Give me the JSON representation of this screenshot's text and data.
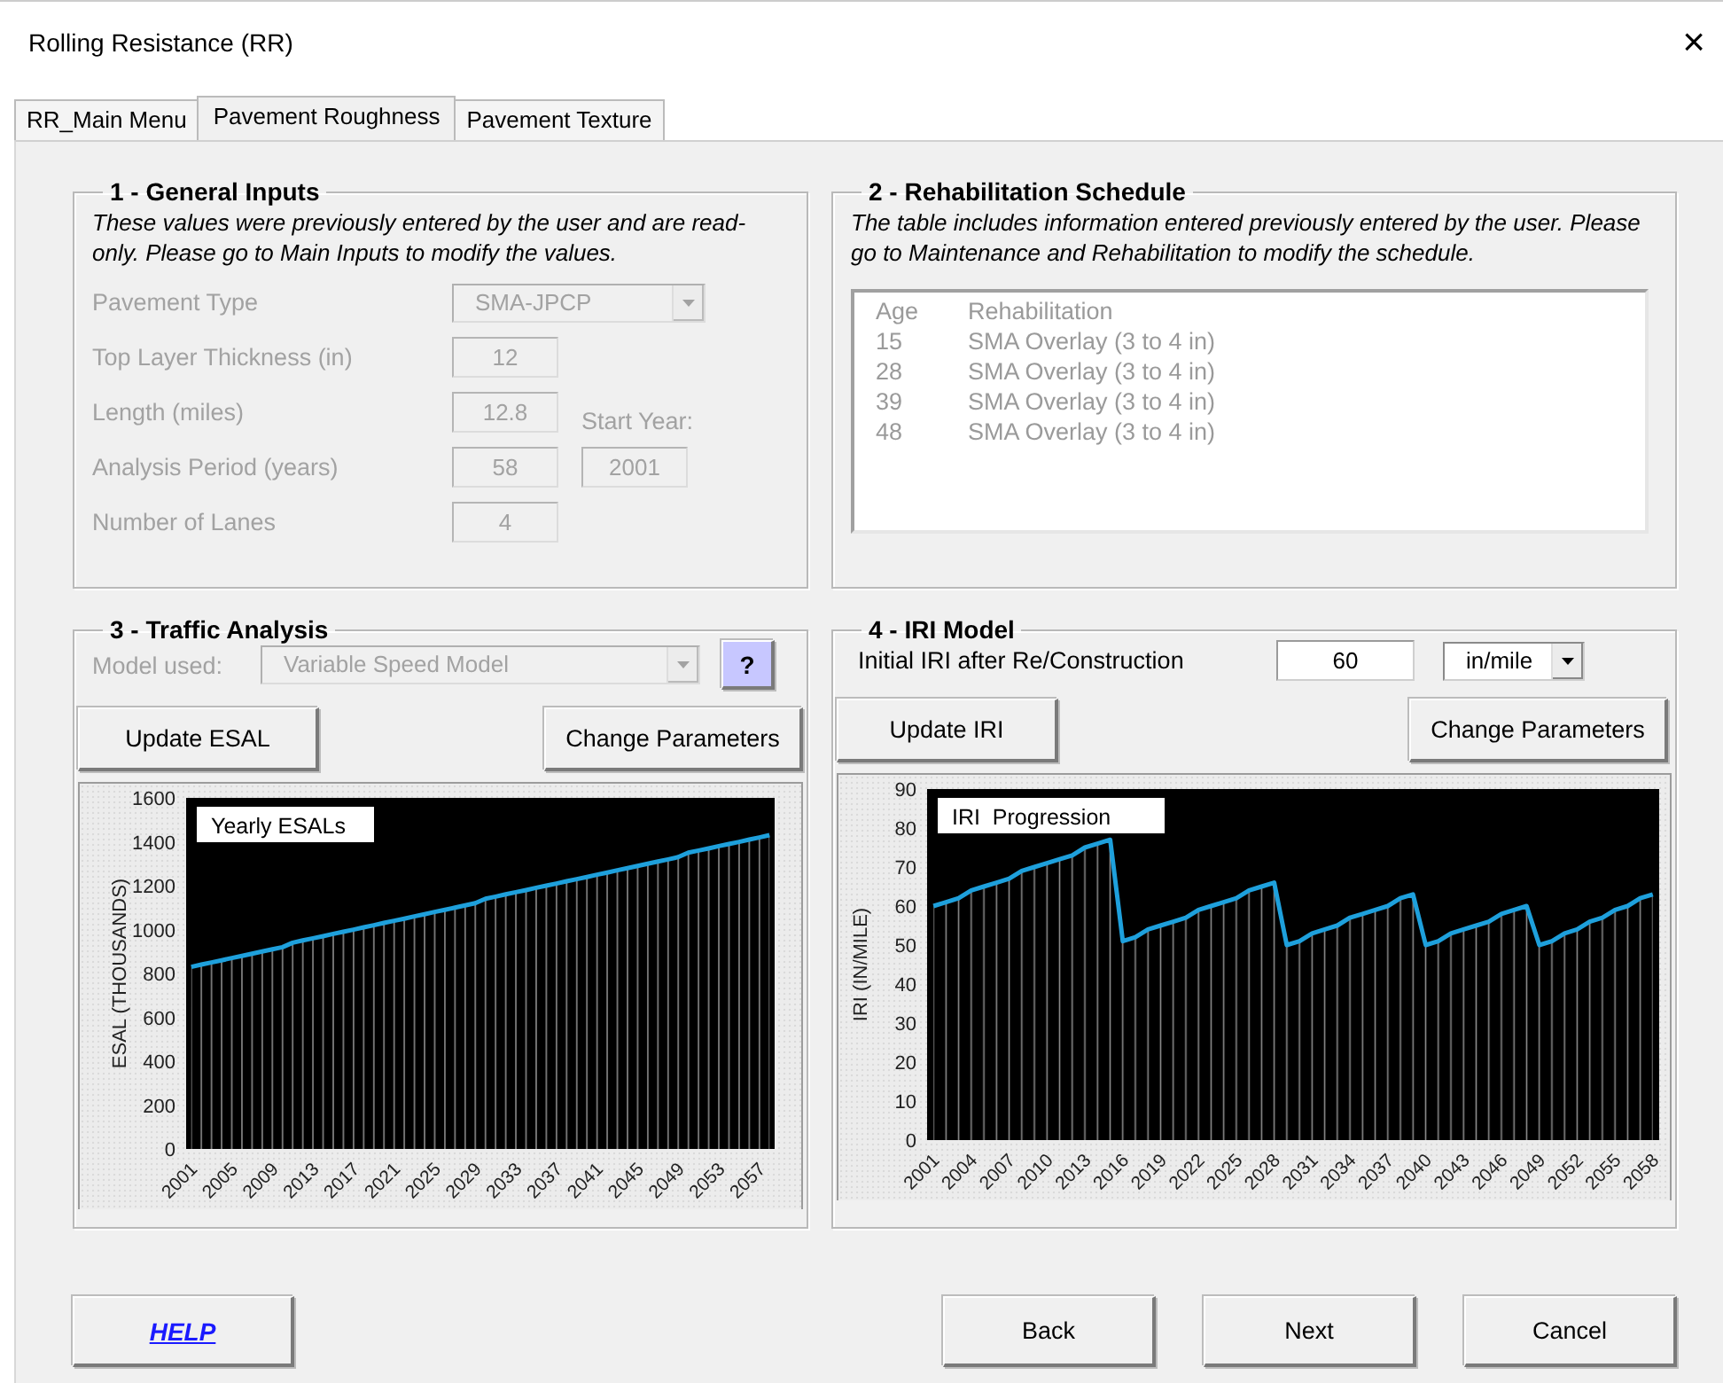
{
  "window": {
    "title": "Rolling Resistance (RR)",
    "close": "×"
  },
  "tabs": [
    {
      "label": "RR_Main Menu",
      "selected": false
    },
    {
      "label": "Pavement Roughness",
      "selected": true
    },
    {
      "label": "Pavement Texture",
      "selected": false
    }
  ],
  "general_inputs": {
    "title": "1 - General Inputs",
    "note": "These values were previously entered by the user and are read-only. Please go to Main Inputs to modify the values.",
    "fields": [
      {
        "label": "Pavement Type",
        "value": "SMA-JPCP",
        "kind": "dropdown",
        "disabled": true
      },
      {
        "label": "Top Layer Thickness (in)",
        "value": "12",
        "kind": "text",
        "disabled": true
      },
      {
        "label": "Length (miles)",
        "value": "12.8",
        "kind": "text",
        "disabled": true
      },
      {
        "label": "Analysis Period (years)",
        "value": "58",
        "kind": "text",
        "disabled": true
      },
      {
        "label": "Number of Lanes",
        "value": "4",
        "kind": "text",
        "disabled": true
      }
    ],
    "start_year": {
      "label": "Start Year:",
      "value": "2001",
      "disabled": true
    }
  },
  "rehabilitation_schedule": {
    "title": "2 - Rehabilitation Schedule",
    "note": "The table includes information entered previously entered by the user. Please go to Maintenance and Rehabilitation to modify the schedule.",
    "disabled": true,
    "columns": [
      "Age",
      "Rehabilitation"
    ],
    "rows": [
      [
        "15",
        "SMA Overlay (3 to 4 in)"
      ],
      [
        "28",
        "SMA Overlay (3 to 4 in)"
      ],
      [
        "39",
        "SMA Overlay (3 to 4 in)"
      ],
      [
        "48",
        "SMA Overlay (3 to 4 in)"
      ]
    ]
  },
  "traffic_analysis": {
    "title": "3 - Traffic Analysis",
    "model": {
      "label": "Model used:",
      "value": "Variable Speed Model",
      "disabled": true
    },
    "help_button": "?",
    "buttons": [
      "Update ESAL",
      "Change Parameters"
    ],
    "chart_data": {
      "type": "area",
      "ylabel": "ESAL (THOUSANDS)",
      "x": [
        2001,
        2002,
        2003,
        2004,
        2005,
        2006,
        2007,
        2008,
        2009,
        2010,
        2011,
        2012,
        2013,
        2014,
        2015,
        2016,
        2017,
        2018,
        2019,
        2020,
        2021,
        2022,
        2023,
        2024,
        2025,
        2026,
        2027,
        2028,
        2029,
        2030,
        2031,
        2032,
        2033,
        2034,
        2035,
        2036,
        2037,
        2038,
        2039,
        2040,
        2041,
        2042,
        2043,
        2044,
        2045,
        2046,
        2047,
        2048,
        2049,
        2050,
        2051,
        2052,
        2053,
        2054,
        2055,
        2056,
        2057,
        2058
      ],
      "series": [
        {
          "name": "Yearly ESALs",
          "color": "#1ea0dc",
          "values": [
            830,
            840,
            850,
            860,
            870,
            880,
            890,
            900,
            910,
            920,
            940,
            950,
            960,
            970,
            980,
            990,
            1000,
            1010,
            1020,
            1030,
            1040,
            1050,
            1060,
            1070,
            1080,
            1090,
            1100,
            1110,
            1120,
            1140,
            1150,
            1160,
            1170,
            1180,
            1190,
            1200,
            1210,
            1220,
            1230,
            1240,
            1250,
            1260,
            1270,
            1280,
            1290,
            1300,
            1310,
            1320,
            1330,
            1350,
            1360,
            1370,
            1380,
            1390,
            1400,
            1410,
            1420,
            1430
          ]
        }
      ],
      "xlim": [
        2000.5,
        2058.5
      ],
      "ylim": [
        0,
        1600
      ],
      "yticks": [
        0,
        200,
        400,
        600,
        800,
        1000,
        1200,
        1400,
        1600
      ],
      "xticks": [
        2001,
        2005,
        2009,
        2013,
        2017,
        2021,
        2025,
        2029,
        2033,
        2037,
        2041,
        2045,
        2049,
        2053,
        2057
      ]
    }
  },
  "iri_model": {
    "title": "4 - IRI Model",
    "initial_iri": {
      "label": "Initial IRI after Re/Construction",
      "value": "60"
    },
    "unit": {
      "value": "in/mile"
    },
    "buttons": [
      "Update IRI",
      "Change Parameters"
    ],
    "chart_data": {
      "type": "area",
      "ylabel": "IRI (IN/MILE)",
      "x": [
        2001,
        2002,
        2003,
        2004,
        2005,
        2006,
        2007,
        2008,
        2009,
        2010,
        2011,
        2012,
        2013,
        2014,
        2015,
        2016,
        2017,
        2018,
        2019,
        2020,
        2021,
        2022,
        2023,
        2024,
        2025,
        2026,
        2027,
        2028,
        2029,
        2030,
        2031,
        2032,
        2033,
        2034,
        2035,
        2036,
        2037,
        2038,
        2039,
        2040,
        2041,
        2042,
        2043,
        2044,
        2045,
        2046,
        2047,
        2048,
        2049,
        2050,
        2051,
        2052,
        2053,
        2054,
        2055,
        2056,
        2057,
        2058
      ],
      "series": [
        {
          "name": "IRI  Progression",
          "color": "#1ea0dc",
          "values": [
            60,
            61,
            62,
            64,
            65,
            66,
            67,
            69,
            70,
            71,
            72,
            73,
            75,
            76,
            77,
            51,
            52,
            54,
            55,
            56,
            57,
            59,
            60,
            61,
            62,
            64,
            65,
            66,
            50,
            51,
            53,
            54,
            55,
            57,
            58,
            59,
            60,
            62,
            63,
            50,
            51,
            53,
            54,
            55,
            56,
            58,
            59,
            60,
            50,
            51,
            53,
            54,
            56,
            57,
            59,
            60,
            62,
            63
          ]
        }
      ],
      "xlim": [
        2000.5,
        2058.5
      ],
      "ylim": [
        0,
        90
      ],
      "yticks": [
        0,
        10,
        20,
        30,
        40,
        50,
        60,
        70,
        80,
        90
      ],
      "xticks": [
        2001,
        2004,
        2007,
        2010,
        2013,
        2016,
        2019,
        2022,
        2025,
        2028,
        2031,
        2034,
        2037,
        2040,
        2043,
        2046,
        2049,
        2052,
        2055,
        2058
      ]
    }
  },
  "footer": {
    "help": "HELP",
    "buttons": [
      "Back",
      "Next",
      "Cancel"
    ]
  }
}
